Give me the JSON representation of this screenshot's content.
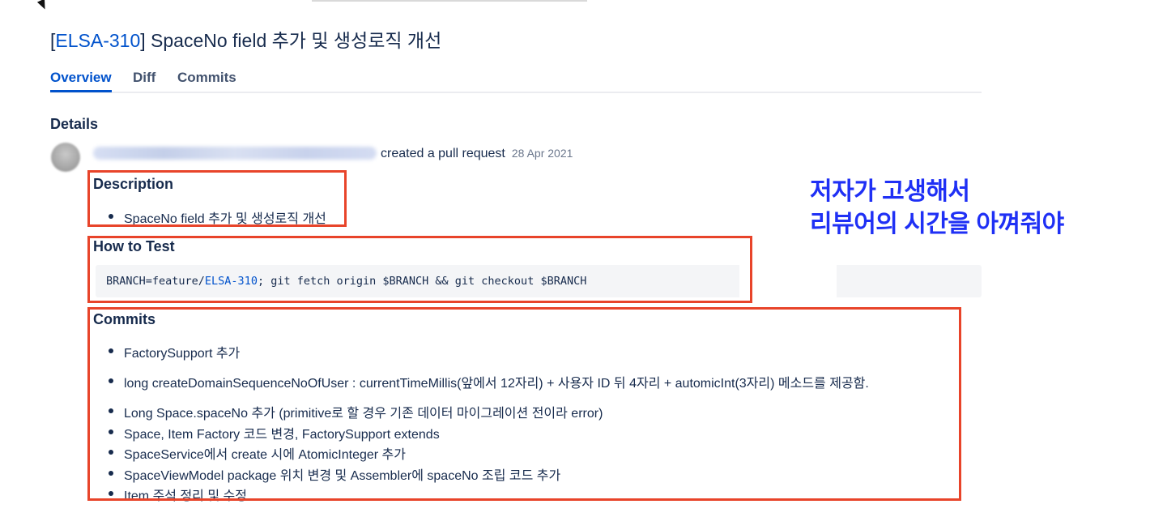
{
  "title": {
    "open_bracket": "[",
    "issue_key": "ELSA-310",
    "text": "] SpaceNo field 추가 및 생성로직 개선"
  },
  "tabs": [
    {
      "label": "Overview",
      "active": true
    },
    {
      "label": "Diff",
      "active": false
    },
    {
      "label": "Commits",
      "active": false
    }
  ],
  "details": {
    "heading": "Details",
    "activity": "created a pull request",
    "date": "28 Apr 2021"
  },
  "description": {
    "heading": "Description",
    "items": [
      "SpaceNo field 추가 및 생성로직 개선"
    ]
  },
  "how_to_test": {
    "heading": "How to Test",
    "code_prefix": "BRANCH=feature/",
    "code_ref": "ELSA-310",
    "code_suffix": "; git fetch origin $BRANCH && git checkout $BRANCH"
  },
  "commits": {
    "heading": "Commits",
    "items": [
      "FactorySupport 추가",
      "long createDomainSequenceNoOfUser : currentTimeMillis(앞에서 12자리) + 사용자 ID 뒤 4자리 + automicInt(3자리) 메소드를 제공함.",
      "Long Space.spaceNo 추가 (primitive로 할 경우 기존 데이터 마이그레이션 전이라 error)",
      "Space, Item Factory 코드 변경, FactorySupport extends",
      "SpaceService에서 create 시에 AtomicInteger 추가",
      "SpaceViewModel package 위치 변경 및 Assembler에 spaceNo 조립 코드 추가",
      "Item 주석 정리 및 수정"
    ]
  },
  "annotation": {
    "line1": "저자가 고생해서",
    "line2": "리뷰어의 시간을 아껴줘야",
    "color": "#1f30f5"
  },
  "highlight_color": "#e8442a"
}
